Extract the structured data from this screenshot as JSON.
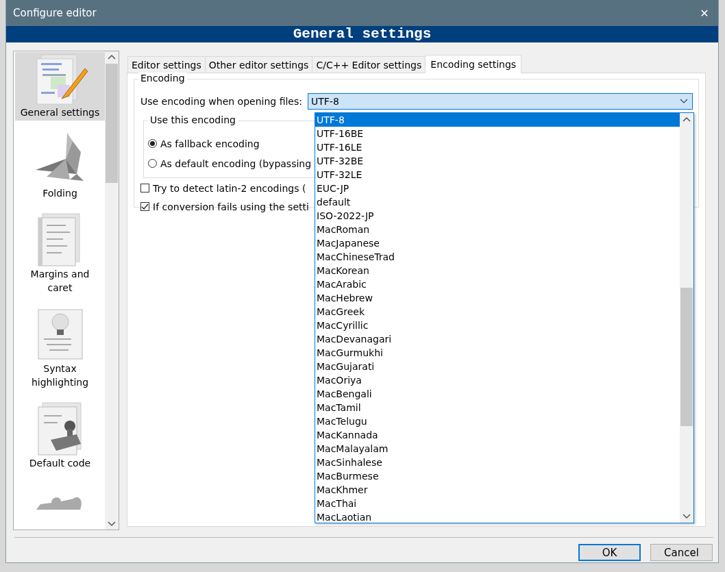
{
  "window": {
    "title": "Configure editor",
    "close": "✕"
  },
  "header": "General settings",
  "sidebar": {
    "items": [
      {
        "kind": "pencil",
        "label": "General settings",
        "selected": true
      },
      {
        "kind": "origami",
        "label": "Folding",
        "selected": false
      },
      {
        "kind": "pages",
        "label": "Margins and caret",
        "selected": false
      },
      {
        "kind": "bulb",
        "label": "Syntax highlighting",
        "selected": false
      },
      {
        "kind": "stamp",
        "label": "Default code",
        "selected": false
      },
      {
        "kind": "puzzle",
        "selected": false
      }
    ]
  },
  "tabs": [
    {
      "label": "Editor settings",
      "selected": false
    },
    {
      "label": "Other editor settings",
      "selected": false
    },
    {
      "label": "C/C++ Editor settings",
      "selected": false
    },
    {
      "label": "Encoding settings",
      "selected": true
    }
  ],
  "encoding": {
    "title": "Encoding",
    "label": "Use encoding when opening files:",
    "value": "UTF-8",
    "expanded": true,
    "options": [
      {
        "label": "UTF-8",
        "selected": true
      },
      {
        "label": "UTF-16BE",
        "selected": false
      },
      {
        "label": "UTF-16LE",
        "selected": false
      },
      {
        "label": "UTF-32BE",
        "selected": false
      },
      {
        "label": "UTF-32LE",
        "selected": false
      },
      {
        "label": "EUC-JP",
        "selected": false
      },
      {
        "label": "default",
        "selected": false
      },
      {
        "label": "ISO-2022-JP",
        "selected": false
      },
      {
        "label": "MacRoman",
        "selected": false
      },
      {
        "label": "MacJapanese",
        "selected": false
      },
      {
        "label": "MacChineseTrad",
        "selected": false
      },
      {
        "label": "MacKorean",
        "selected": false
      },
      {
        "label": "MacArabic",
        "selected": false
      },
      {
        "label": "MacHebrew",
        "selected": false
      },
      {
        "label": "MacGreek",
        "selected": false
      },
      {
        "label": "MacCyrillic",
        "selected": false
      },
      {
        "label": "MacDevanagari",
        "selected": false
      },
      {
        "label": "MacGurmukhi",
        "selected": false
      },
      {
        "label": "MacGujarati",
        "selected": false
      },
      {
        "label": "MacOriya",
        "selected": false
      },
      {
        "label": "MacBengali",
        "selected": false
      },
      {
        "label": "MacTamil",
        "selected": false
      },
      {
        "label": "MacTelugu",
        "selected": false
      },
      {
        "label": "MacKannada",
        "selected": false
      },
      {
        "label": "MacMalayalam",
        "selected": false
      },
      {
        "label": "MacSinhalese",
        "selected": false
      },
      {
        "label": "MacBurmese",
        "selected": false
      },
      {
        "label": "MacKhmer",
        "selected": false
      },
      {
        "label": "MacThai",
        "selected": false
      },
      {
        "label": "MacLaotian",
        "selected": false
      }
    ],
    "subgroup": {
      "title": "Use this encoding",
      "radios": [
        {
          "label": "As fallback encoding",
          "selected": true
        },
        {
          "label": "As default encoding (bypassing",
          "selected": false
        }
      ]
    },
    "checkboxes": [
      {
        "label": "Try to detect latin-2 encodings (",
        "checked": false
      },
      {
        "label": "If conversion fails using the setti",
        "checked": true
      }
    ]
  },
  "buttons": [
    {
      "label": "OK",
      "default": true
    },
    {
      "label": "Cancel",
      "default": false
    }
  ]
}
